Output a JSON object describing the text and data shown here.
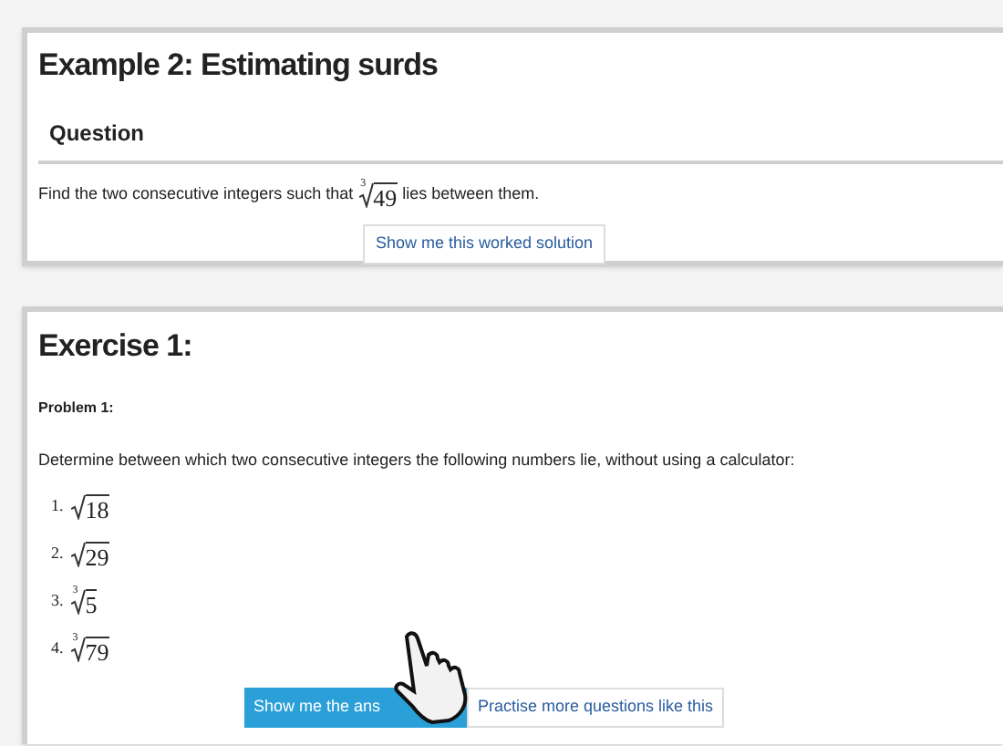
{
  "example": {
    "title": "Example 2: Estimating surds",
    "section": "Question",
    "question": {
      "before": "Find the two consecutive integers such that",
      "root": {
        "index": "3",
        "radicand": "49"
      },
      "after": "lies between them."
    },
    "button": "Show me this worked solution"
  },
  "exercise": {
    "title": "Exercise 1:",
    "problem": "Problem 1:",
    "instruction": "Determine between which two consecutive integers the following numbers lie, without using a calculator:",
    "items": [
      {
        "number": "1.",
        "root": {
          "radicand": "18"
        }
      },
      {
        "number": "2.",
        "root": {
          "radicand": "29"
        }
      },
      {
        "number": "3.",
        "root": {
          "index": "3",
          "radicand": "5"
        }
      },
      {
        "number": "4.",
        "root": {
          "index": "3",
          "radicand": "79"
        }
      }
    ],
    "buttons": [
      {
        "label": "Show me the ans",
        "kind": "primary"
      },
      {
        "label": "Practise more questions like this",
        "kind": "secondary"
      }
    ]
  }
}
